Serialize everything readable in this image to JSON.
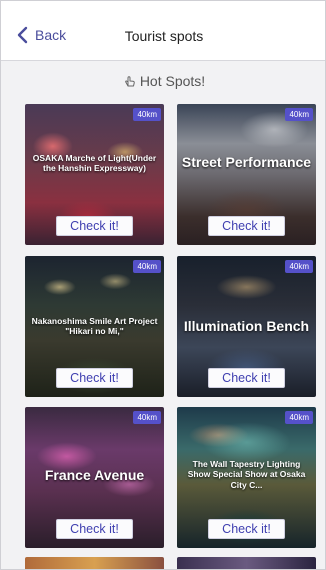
{
  "navbar": {
    "back_label": "Back",
    "title": "Tourist spots"
  },
  "section": {
    "header": "Hot Spots!"
  },
  "cards": [
    {
      "title": "OSAKA Marche of Light(Under the Hanshin Expressway)",
      "distance": "40km",
      "button": "Check it!"
    },
    {
      "title": "Street Performance",
      "distance": "40km",
      "button": "Check it!"
    },
    {
      "title": "Nakanoshima Smile Art Project \"Hikari no Mi,\"",
      "distance": "40km",
      "button": "Check it!"
    },
    {
      "title": "Illumination Bench",
      "distance": "40km",
      "button": "Check it!"
    },
    {
      "title": "France Avenue",
      "distance": "40km",
      "button": "Check it!"
    },
    {
      "title": "The Wall Tapestry Lighting Show Special Show at Osaka City C...",
      "distance": "40km",
      "button": "Check it!"
    }
  ],
  "colors": {
    "accent": "#4a4d9c",
    "badge": "#5551c9",
    "button_text": "#3f3fb0"
  }
}
